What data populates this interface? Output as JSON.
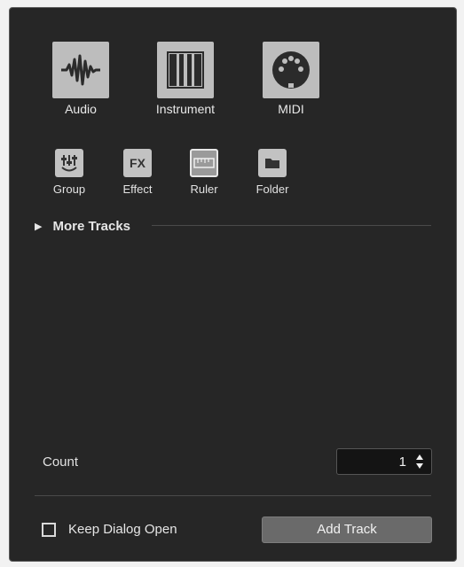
{
  "track_types_main": [
    {
      "label": "Audio",
      "icon": "audio-waveform-icon"
    },
    {
      "label": "Instrument",
      "icon": "piano-keys-icon"
    },
    {
      "label": "MIDI",
      "icon": "midi-connector-icon"
    }
  ],
  "track_types_secondary": [
    {
      "label": "Group",
      "icon": "group-fader-icon"
    },
    {
      "label": "Effect",
      "icon_text": "FX"
    },
    {
      "label": "Ruler",
      "icon": "ruler-icon"
    },
    {
      "label": "Folder",
      "icon": "folder-icon"
    }
  ],
  "more_tracks": {
    "label": "More Tracks"
  },
  "count": {
    "label": "Count",
    "value": "1"
  },
  "keep_dialog_open": {
    "label": "Keep Dialog Open",
    "checked": false
  },
  "add_track": {
    "label": "Add Track"
  }
}
